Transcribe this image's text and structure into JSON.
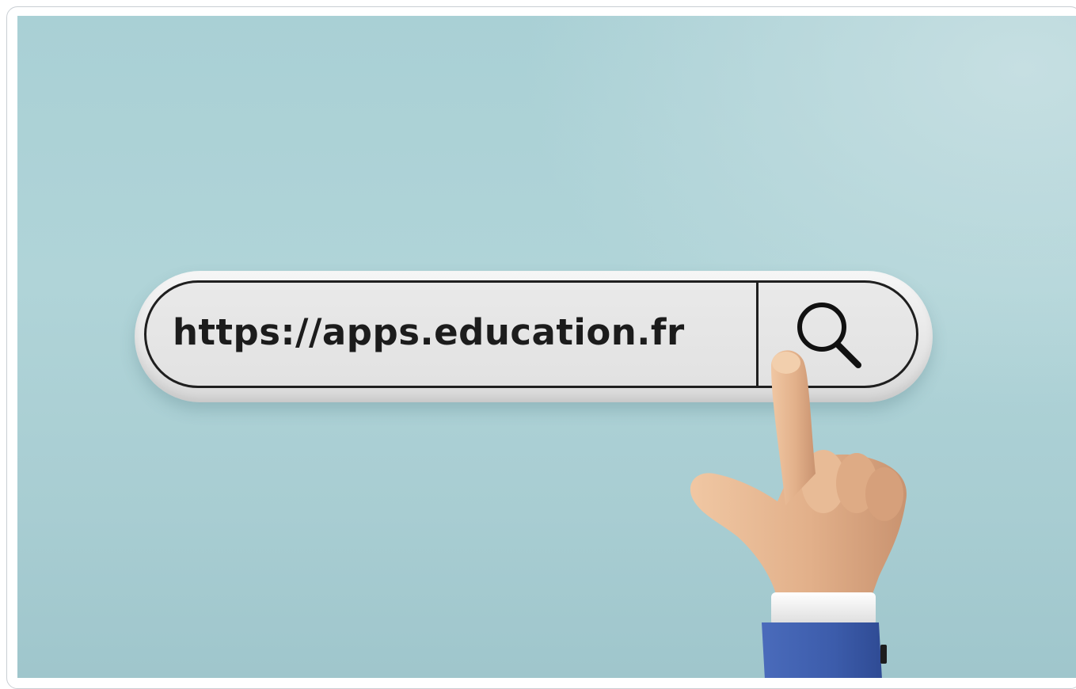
{
  "search_bar": {
    "url_text": "https://apps.education.fr"
  },
  "icons": {
    "search": "search-icon",
    "hand": "pointing-hand-icon"
  },
  "colors": {
    "background": "#a9d0d5",
    "bar": "#e6e6e6",
    "outline": "#1f1f1f",
    "sleeve": "#3f5fae",
    "skin": "#e3b58f"
  }
}
